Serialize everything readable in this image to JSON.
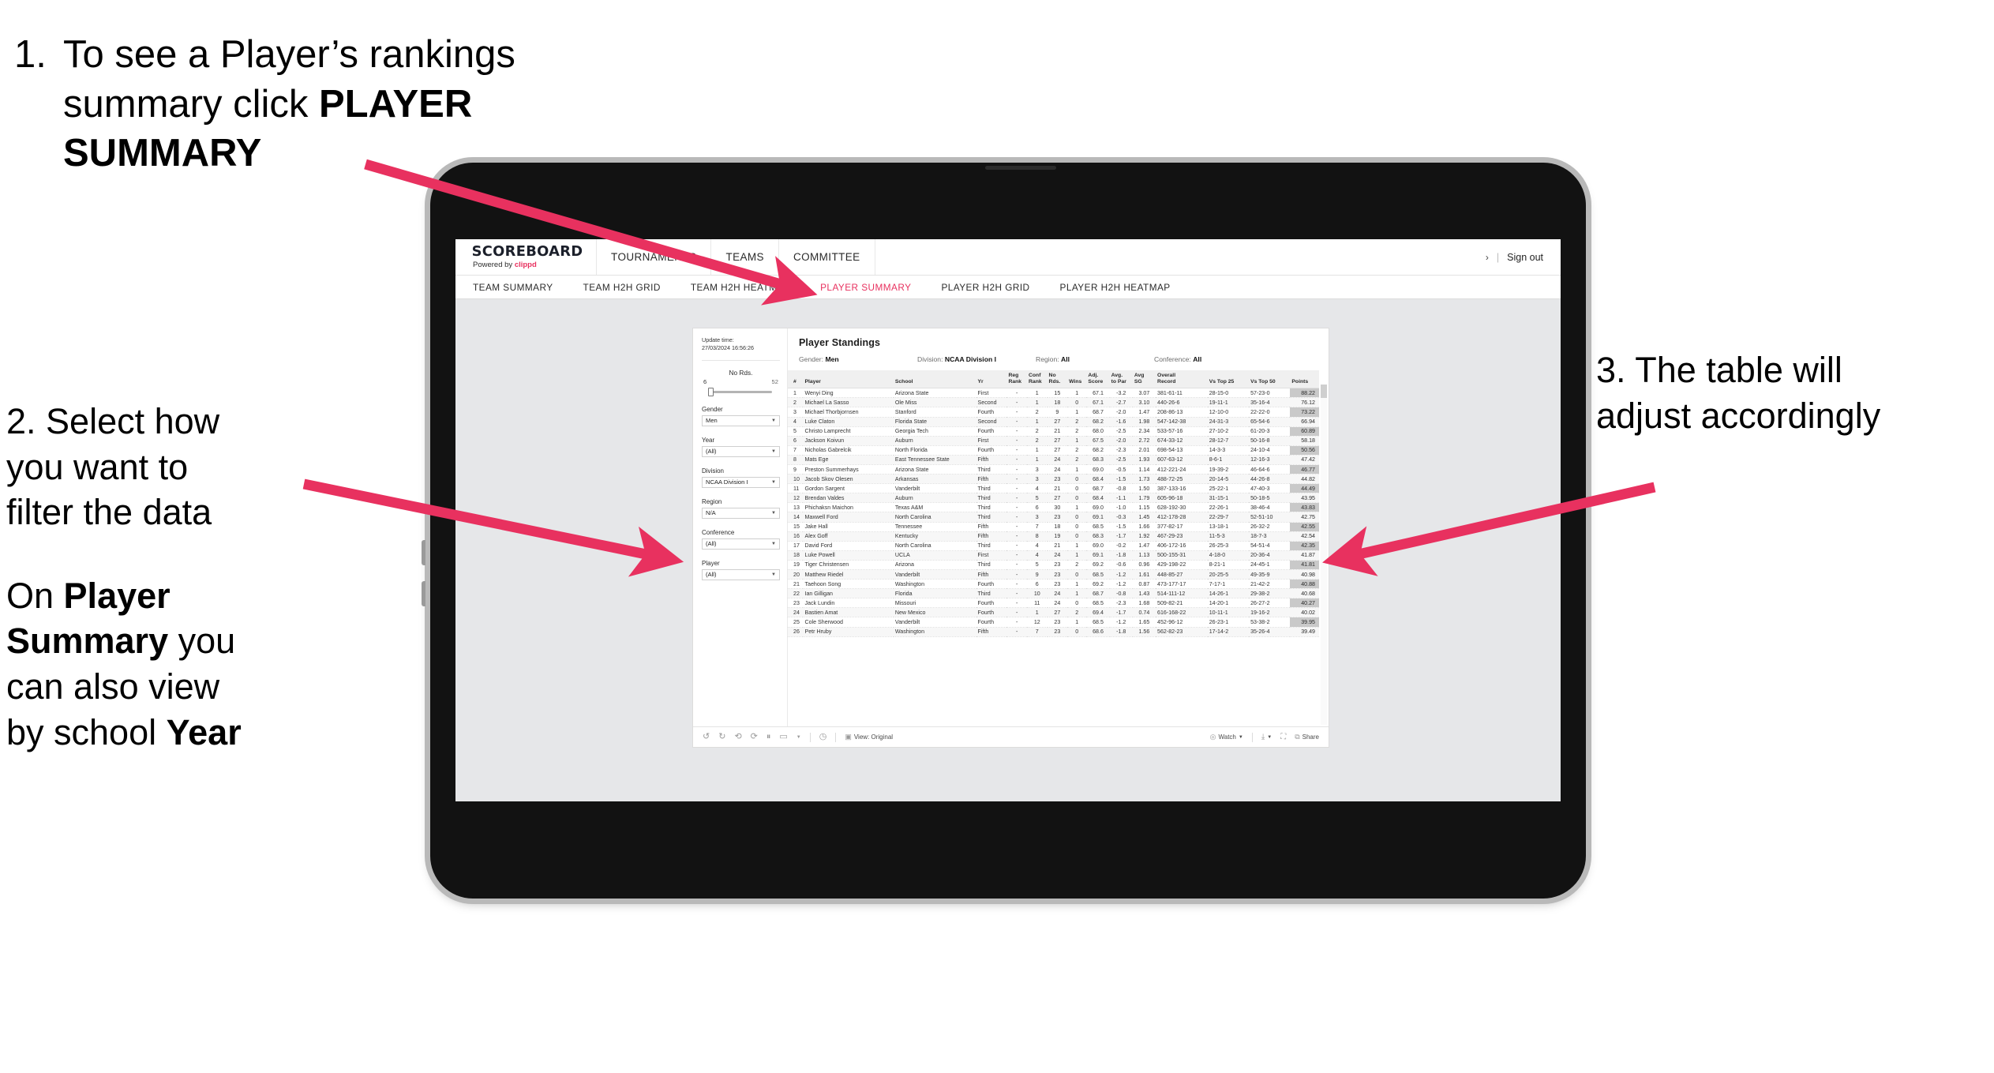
{
  "annotations": {
    "step1": {
      "number": "1.",
      "line1": "To see a Player’s rankings",
      "line2a": "summary click ",
      "line2b": "PLAYER",
      "line3": "SUMMARY"
    },
    "step2": {
      "line1": "2. Select how",
      "line2": "you want to",
      "line3": "filter the data",
      "p2a": "On ",
      "p2b": "Player",
      "p2c": "Summary",
      "p2d": " you",
      "p2e": "can also view",
      "p2f": "by school ",
      "p2g": "Year"
    },
    "step3": {
      "line1": "3. The table will",
      "line2": "adjust accordingly"
    }
  },
  "colors": {
    "accent": "#e8315f",
    "arrow": "#e8315f",
    "points_cell": "#c9c9c9"
  },
  "app": {
    "brand": {
      "name": "SCOREBOARD",
      "powered_prefix": "Powered by ",
      "powered_brand": "clippd"
    },
    "top_nav": [
      {
        "label": "TOURNAMENTS"
      },
      {
        "label": "TEAMS"
      },
      {
        "label": "COMMITTEE"
      }
    ],
    "top_right": {
      "chevron": "›",
      "separator": "|",
      "sign_out": "Sign out"
    },
    "sub_nav": [
      {
        "label": "TEAM SUMMARY",
        "active": false
      },
      {
        "label": "TEAM H2H GRID",
        "active": false
      },
      {
        "label": "TEAM H2H HEATMAP",
        "active": false
      },
      {
        "label": "PLAYER SUMMARY",
        "active": true
      },
      {
        "label": "PLAYER H2H GRID",
        "active": false
      },
      {
        "label": "PLAYER H2H HEATMAP",
        "active": false
      }
    ]
  },
  "filters": {
    "update_label": "Update time:",
    "update_value": "27/03/2024 16:56:26",
    "slider": {
      "label": "No Rds.",
      "min": "6",
      "max": "52"
    },
    "selects": [
      {
        "label": "Gender",
        "value": "Men"
      },
      {
        "label": "Year",
        "value": "(All)"
      },
      {
        "label": "Division",
        "value": "NCAA Division I"
      },
      {
        "label": "Region",
        "value": "N/A"
      },
      {
        "label": "Conference",
        "value": "(All)"
      },
      {
        "label": "Player",
        "value": "(All)"
      }
    ]
  },
  "viz": {
    "title": "Player Standings",
    "subtitle": [
      {
        "key": "Gender:",
        "value": "Men"
      },
      {
        "key": "Division:",
        "value": "NCAA Division I"
      },
      {
        "key": "Region:",
        "value": "All"
      },
      {
        "key": "Conference:",
        "value": "All"
      }
    ],
    "toolbar": {
      "view_label": "View: Original",
      "watch_label": "Watch",
      "share_label": "Share"
    }
  },
  "chart_data": {
    "type": "table",
    "title": "Player Standings",
    "columns": [
      "#",
      "Player",
      "School",
      "Yr",
      "Reg Rank",
      "Conf Rank",
      "No Rds.",
      "Wins",
      "Adj. Score",
      "Avg. to Par",
      "Avg SG",
      "Overall Record",
      "Vs Top 25",
      "Vs Top 50",
      "Points"
    ],
    "column_headers_two_line": [
      {
        "l1": "#",
        "l2": ""
      },
      {
        "l1": "Player",
        "l2": ""
      },
      {
        "l1": "School",
        "l2": ""
      },
      {
        "l1": "Yr",
        "l2": ""
      },
      {
        "l1": "Reg",
        "l2": "Rank"
      },
      {
        "l1": "Conf",
        "l2": "Rank"
      },
      {
        "l1": "No",
        "l2": "Rds."
      },
      {
        "l1": "Wins",
        "l2": ""
      },
      {
        "l1": "Adj.",
        "l2": "Score"
      },
      {
        "l1": "Avg.",
        "l2": "to Par"
      },
      {
        "l1": "Avg",
        "l2": "SG"
      },
      {
        "l1": "Overall",
        "l2": "Record"
      },
      {
        "l1": "Vs Top 25",
        "l2": ""
      },
      {
        "l1": "Vs Top 50",
        "l2": ""
      },
      {
        "l1": "Points",
        "l2": ""
      }
    ],
    "rows": [
      [
        "1",
        "Wenyi Ding",
        "Arizona State",
        "First",
        "-",
        "1",
        "15",
        "1",
        "67.1",
        "-3.2",
        "3.07",
        "381-61-11",
        "28-15-0",
        "57-23-0",
        "88.22"
      ],
      [
        "2",
        "Michael La Sasso",
        "Ole Miss",
        "Second",
        "-",
        "1",
        "18",
        "0",
        "67.1",
        "-2.7",
        "3.10",
        "440-26-6",
        "19-11-1",
        "35-16-4",
        "76.12"
      ],
      [
        "3",
        "Michael Thorbjornsen",
        "Stanford",
        "Fourth",
        "-",
        "2",
        "9",
        "1",
        "68.7",
        "-2.0",
        "1.47",
        "208-86-13",
        "12-10-0",
        "22-22-0",
        "73.22"
      ],
      [
        "4",
        "Luke Claton",
        "Florida State",
        "Second",
        "-",
        "1",
        "27",
        "2",
        "68.2",
        "-1.6",
        "1.98",
        "547-142-38",
        "24-31-3",
        "65-54-6",
        "66.94"
      ],
      [
        "5",
        "Christo Lamprecht",
        "Georgia Tech",
        "Fourth",
        "-",
        "2",
        "21",
        "2",
        "68.0",
        "-2.5",
        "2.34",
        "533-57-16",
        "27-10-2",
        "61-20-3",
        "60.89"
      ],
      [
        "6",
        "Jackson Koivun",
        "Auburn",
        "First",
        "-",
        "2",
        "27",
        "1",
        "67.5",
        "-2.0",
        "2.72",
        "674-33-12",
        "28-12-7",
        "50-16-8",
        "58.18"
      ],
      [
        "7",
        "Nicholas Gabrelcik",
        "North Florida",
        "Fourth",
        "-",
        "1",
        "27",
        "2",
        "68.2",
        "-2.3",
        "2.01",
        "698-54-13",
        "14-3-3",
        "24-10-4",
        "50.56"
      ],
      [
        "8",
        "Mats Ege",
        "East Tennessee State",
        "Fifth",
        "-",
        "1",
        "24",
        "2",
        "68.3",
        "-2.5",
        "1.93",
        "607-63-12",
        "8-6-1",
        "12-16-3",
        "47.42"
      ],
      [
        "9",
        "Preston Summerhays",
        "Arizona State",
        "Third",
        "-",
        "3",
        "24",
        "1",
        "69.0",
        "-0.5",
        "1.14",
        "412-221-24",
        "19-39-2",
        "46-64-6",
        "46.77"
      ],
      [
        "10",
        "Jacob Skov Olesen",
        "Arkansas",
        "Fifth",
        "-",
        "3",
        "23",
        "0",
        "68.4",
        "-1.5",
        "1.73",
        "488-72-25",
        "20-14-5",
        "44-26-8",
        "44.82"
      ],
      [
        "11",
        "Gordon Sargent",
        "Vanderbilt",
        "Third",
        "-",
        "4",
        "21",
        "0",
        "68.7",
        "-0.8",
        "1.50",
        "387-133-16",
        "25-22-1",
        "47-40-3",
        "44.49"
      ],
      [
        "12",
        "Brendan Valdes",
        "Auburn",
        "Third",
        "-",
        "5",
        "27",
        "0",
        "68.4",
        "-1.1",
        "1.79",
        "605-96-18",
        "31-15-1",
        "50-18-5",
        "43.95"
      ],
      [
        "13",
        "Phichaksn Maichon",
        "Texas A&M",
        "Third",
        "-",
        "6",
        "30",
        "1",
        "69.0",
        "-1.0",
        "1.15",
        "628-192-30",
        "22-26-1",
        "38-46-4",
        "43.83"
      ],
      [
        "14",
        "Maxwell Ford",
        "North Carolina",
        "Third",
        "-",
        "3",
        "23",
        "0",
        "69.1",
        "-0.3",
        "1.45",
        "412-178-28",
        "22-29-7",
        "52-51-10",
        "42.75"
      ],
      [
        "15",
        "Jake Hall",
        "Tennessee",
        "Fifth",
        "-",
        "7",
        "18",
        "0",
        "68.5",
        "-1.5",
        "1.66",
        "377-82-17",
        "13-18-1",
        "26-32-2",
        "42.55"
      ],
      [
        "16",
        "Alex Goff",
        "Kentucky",
        "Fifth",
        "-",
        "8",
        "19",
        "0",
        "68.3",
        "-1.7",
        "1.92",
        "467-29-23",
        "11-5-3",
        "18-7-3",
        "42.54"
      ],
      [
        "17",
        "David Ford",
        "North Carolina",
        "Third",
        "-",
        "4",
        "21",
        "1",
        "69.0",
        "-0.2",
        "1.47",
        "406-172-16",
        "26-25-3",
        "54-51-4",
        "42.35"
      ],
      [
        "18",
        "Luke Powell",
        "UCLA",
        "First",
        "-",
        "4",
        "24",
        "1",
        "69.1",
        "-1.8",
        "1.13",
        "500-155-31",
        "4-18-0",
        "20-36-4",
        "41.87"
      ],
      [
        "19",
        "Tiger Christensen",
        "Arizona",
        "Third",
        "-",
        "5",
        "23",
        "2",
        "69.2",
        "-0.6",
        "0.96",
        "429-198-22",
        "8-21-1",
        "24-45-1",
        "41.81"
      ],
      [
        "20",
        "Matthew Riedel",
        "Vanderbilt",
        "Fifth",
        "-",
        "9",
        "23",
        "0",
        "68.5",
        "-1.2",
        "1.61",
        "448-85-27",
        "20-25-5",
        "49-35-9",
        "40.98"
      ],
      [
        "21",
        "Taehoon Song",
        "Washington",
        "Fourth",
        "-",
        "6",
        "23",
        "1",
        "69.2",
        "-1.2",
        "0.87",
        "473-177-17",
        "7-17-1",
        "21-42-2",
        "40.88"
      ],
      [
        "22",
        "Ian Gilligan",
        "Florida",
        "Third",
        "-",
        "10",
        "24",
        "1",
        "68.7",
        "-0.8",
        "1.43",
        "514-111-12",
        "14-26-1",
        "29-38-2",
        "40.68"
      ],
      [
        "23",
        "Jack Lundin",
        "Missouri",
        "Fourth",
        "-",
        "11",
        "24",
        "0",
        "68.5",
        "-2.3",
        "1.68",
        "509-82-21",
        "14-20-1",
        "26-27-2",
        "40.27"
      ],
      [
        "24",
        "Bastien Amat",
        "New Mexico",
        "Fourth",
        "-",
        "1",
        "27",
        "2",
        "69.4",
        "-1.7",
        "0.74",
        "616-168-22",
        "10-11-1",
        "19-16-2",
        "40.02"
      ],
      [
        "25",
        "Cole Sherwood",
        "Vanderbilt",
        "Fourth",
        "-",
        "12",
        "23",
        "1",
        "68.5",
        "-1.2",
        "1.65",
        "452-96-12",
        "26-23-1",
        "53-38-2",
        "39.95"
      ],
      [
        "26",
        "Petr Hruby",
        "Washington",
        "Fifth",
        "-",
        "7",
        "23",
        "0",
        "68.6",
        "-1.8",
        "1.56",
        "562-82-23",
        "17-14-2",
        "35-26-4",
        "39.49"
      ]
    ],
    "highlight_column": "Points"
  }
}
